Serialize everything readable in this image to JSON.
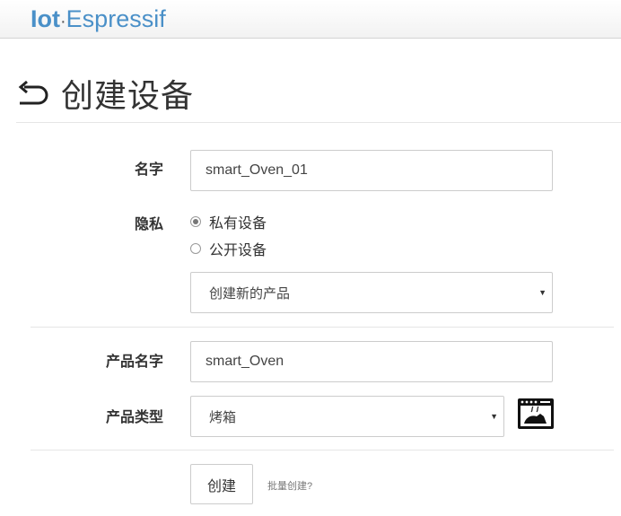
{
  "navbar": {
    "brand_part1": "Iot",
    "brand_dot": "·",
    "brand_part2": "Espressif"
  },
  "header": {
    "title": "创建设备",
    "back_icon": "back-arrow-icon"
  },
  "form": {
    "name_label": "名字",
    "name_value": "smart_Oven_01",
    "privacy_label": "隐私",
    "privacy_options": [
      {
        "label": "私有设备",
        "checked": true
      },
      {
        "label": "公开设备",
        "checked": false
      }
    ],
    "product_select_value": "创建新的产品",
    "product_name_label": "产品名字",
    "product_name_value": "smart_Oven",
    "product_type_label": "产品类型",
    "product_type_value": "烤箱",
    "product_type_icon": "oven-icon",
    "create_button_label": "创建",
    "batch_create_link": "批量创建?"
  },
  "colors": {
    "brand": "#4a90c8",
    "border": "#cccccc"
  }
}
